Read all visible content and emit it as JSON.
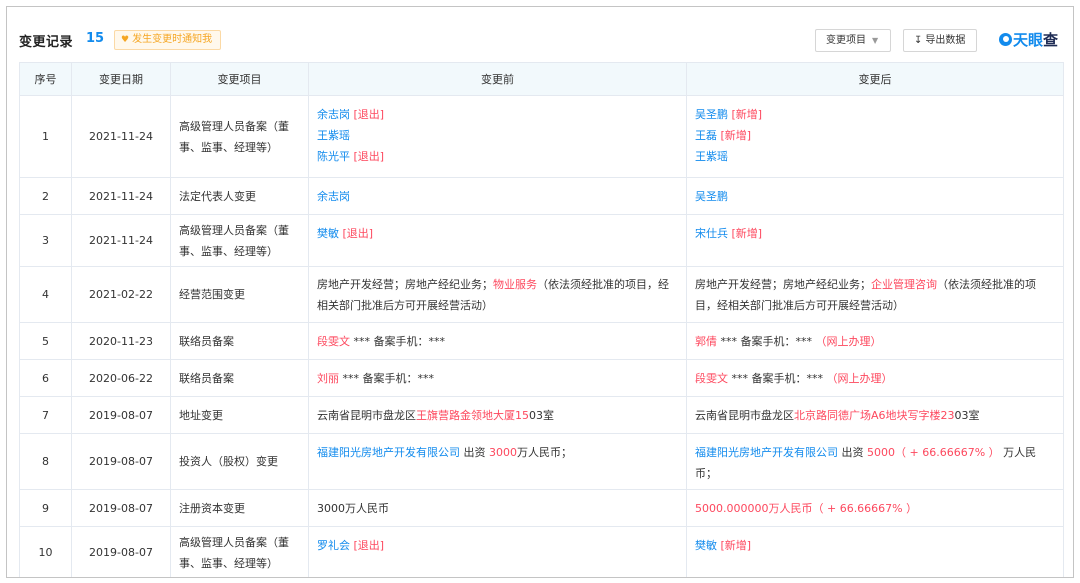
{
  "header": {
    "title": "变更记录",
    "count": "15",
    "notify_label": "发生变更时通知我",
    "change_item_label": "变更项目",
    "export_label": "导出数据",
    "brand": {
      "part1": "天眼",
      "part2": "查"
    }
  },
  "table": {
    "columns": [
      "序号",
      "变更日期",
      "变更项目",
      "变更前",
      "变更后"
    ],
    "rows": [
      {
        "num": "1",
        "date": "2021-11-24",
        "item": "高级管理人员备案（董事、监事、经理等）",
        "before": [
          {
            "name": "余志岗",
            "tag": "[退出]"
          },
          {
            "name": "王紫瑶",
            "tag": ""
          },
          {
            "name": "陈光平",
            "tag": "[退出]"
          }
        ],
        "after": [
          {
            "name": "吴圣鹏",
            "tag": "[新增]"
          },
          {
            "name": "王磊",
            "tag": "[新增]"
          },
          {
            "name": "王紫瑶",
            "tag": ""
          }
        ]
      },
      {
        "num": "2",
        "date": "2021-11-24",
        "item": "法定代表人变更",
        "before": [
          {
            "name": "余志岗",
            "tag": ""
          }
        ],
        "after": [
          {
            "name": "吴圣鹏",
            "tag": ""
          }
        ]
      },
      {
        "num": "3",
        "date": "2021-11-24",
        "item": "高级管理人员备案（董事、监事、经理等）",
        "before": [
          {
            "name": "樊敏",
            "tag": "[退出]"
          }
        ],
        "after": [
          {
            "name": "宋仕兵",
            "tag": "[新增]"
          }
        ]
      },
      {
        "num": "4",
        "date": "2021-02-22",
        "item": "经营范围变更",
        "before": {
          "pre": "房地产开发经营；房地产经纪业务；",
          "hl": "物业服务",
          "post": "（依法须经批准的项目，经相关部门批准后方可开展经营活动）"
        },
        "after": {
          "pre": "房地产开发经营；房地产经纪业务；",
          "hl": "企业管理咨询",
          "post": "（依法须经批准的项目，经相关部门批准后方可开展经营活动）"
        }
      },
      {
        "num": "5",
        "date": "2020-11-23",
        "item": "联络员备案",
        "before": {
          "name": "段雯文",
          "rest": " *** 备案手机：***",
          "extra": ""
        },
        "after": {
          "name": "郭倩",
          "rest": " *** 备案手机：*** ",
          "extra": "（网上办理）"
        }
      },
      {
        "num": "6",
        "date": "2020-06-22",
        "item": "联络员备案",
        "before": {
          "name": "刘丽",
          "rest": " *** 备案手机：***",
          "extra": ""
        },
        "after": {
          "name": "段雯文",
          "rest": " *** 备案手机：*** ",
          "extra": "（网上办理）"
        }
      },
      {
        "num": "7",
        "date": "2019-08-07",
        "item": "地址变更",
        "before": {
          "pre": "云南省昆明市盘龙区",
          "hl": "王旗营路金领地大厦15",
          "post": "03室"
        },
        "after": {
          "pre": "云南省昆明市盘龙区",
          "hl": "北京路同德广场A6地块写字楼23",
          "post": "03室"
        }
      },
      {
        "num": "8",
        "date": "2019-08-07",
        "item": "投资人（股权）变更",
        "before": {
          "company": "福建阳光房地产开发有限公司",
          "mid": " 出资 ",
          "amount": "3000",
          "post": "万人民币；"
        },
        "after": {
          "company": "福建阳光房地产开发有限公司",
          "mid": " 出资 ",
          "amount": "5000（ + 66.66667% ）",
          "post": " 万人民币；"
        }
      },
      {
        "num": "9",
        "date": "2019-08-07",
        "item": "注册资本变更",
        "before": "3000万人民币",
        "after": "5000.000000万人民币（ + 66.66667% ）"
      },
      {
        "num": "10",
        "date": "2019-08-07",
        "item": "高级管理人员备案（董事、监事、经理等）",
        "before": [
          {
            "name": "罗礼会",
            "tag": "[退出]"
          }
        ],
        "after": [
          {
            "name": "樊敏",
            "tag": "[新增]"
          }
        ]
      }
    ]
  },
  "colors": {
    "accent": "#128bed",
    "highlight": "#fd485e",
    "header_bg": "#f2f9fc",
    "notify_text": "#f5a623"
  }
}
